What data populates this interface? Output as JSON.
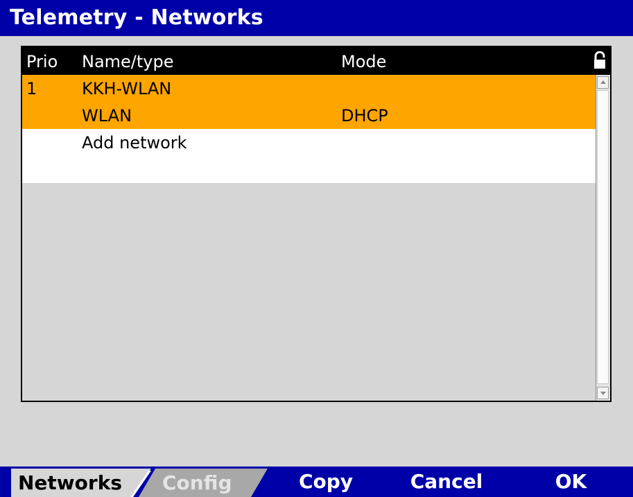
{
  "window": {
    "title": "Telemetry - Networks"
  },
  "table": {
    "headers": {
      "prio": "Prio",
      "name": "Name/type",
      "mode": "Mode"
    },
    "lock_icon": "padlock-icon",
    "rows": [
      {
        "prio": "1",
        "name": "KKH-WLAN",
        "mode": "",
        "selected": true
      },
      {
        "prio": "",
        "name": "WLAN",
        "mode": "DHCP",
        "selected": true
      },
      {
        "prio": "",
        "name": "Add network",
        "mode": "",
        "selected": false
      }
    ]
  },
  "tabs": {
    "networks": "Networks",
    "config": "Config"
  },
  "softkeys": {
    "copy": "Copy",
    "cancel": "Cancel",
    "ok": "OK"
  },
  "colors": {
    "titlebar": "#0000a8",
    "selection": "#ffa500",
    "background": "#d6d6d6",
    "header": "#000000"
  }
}
